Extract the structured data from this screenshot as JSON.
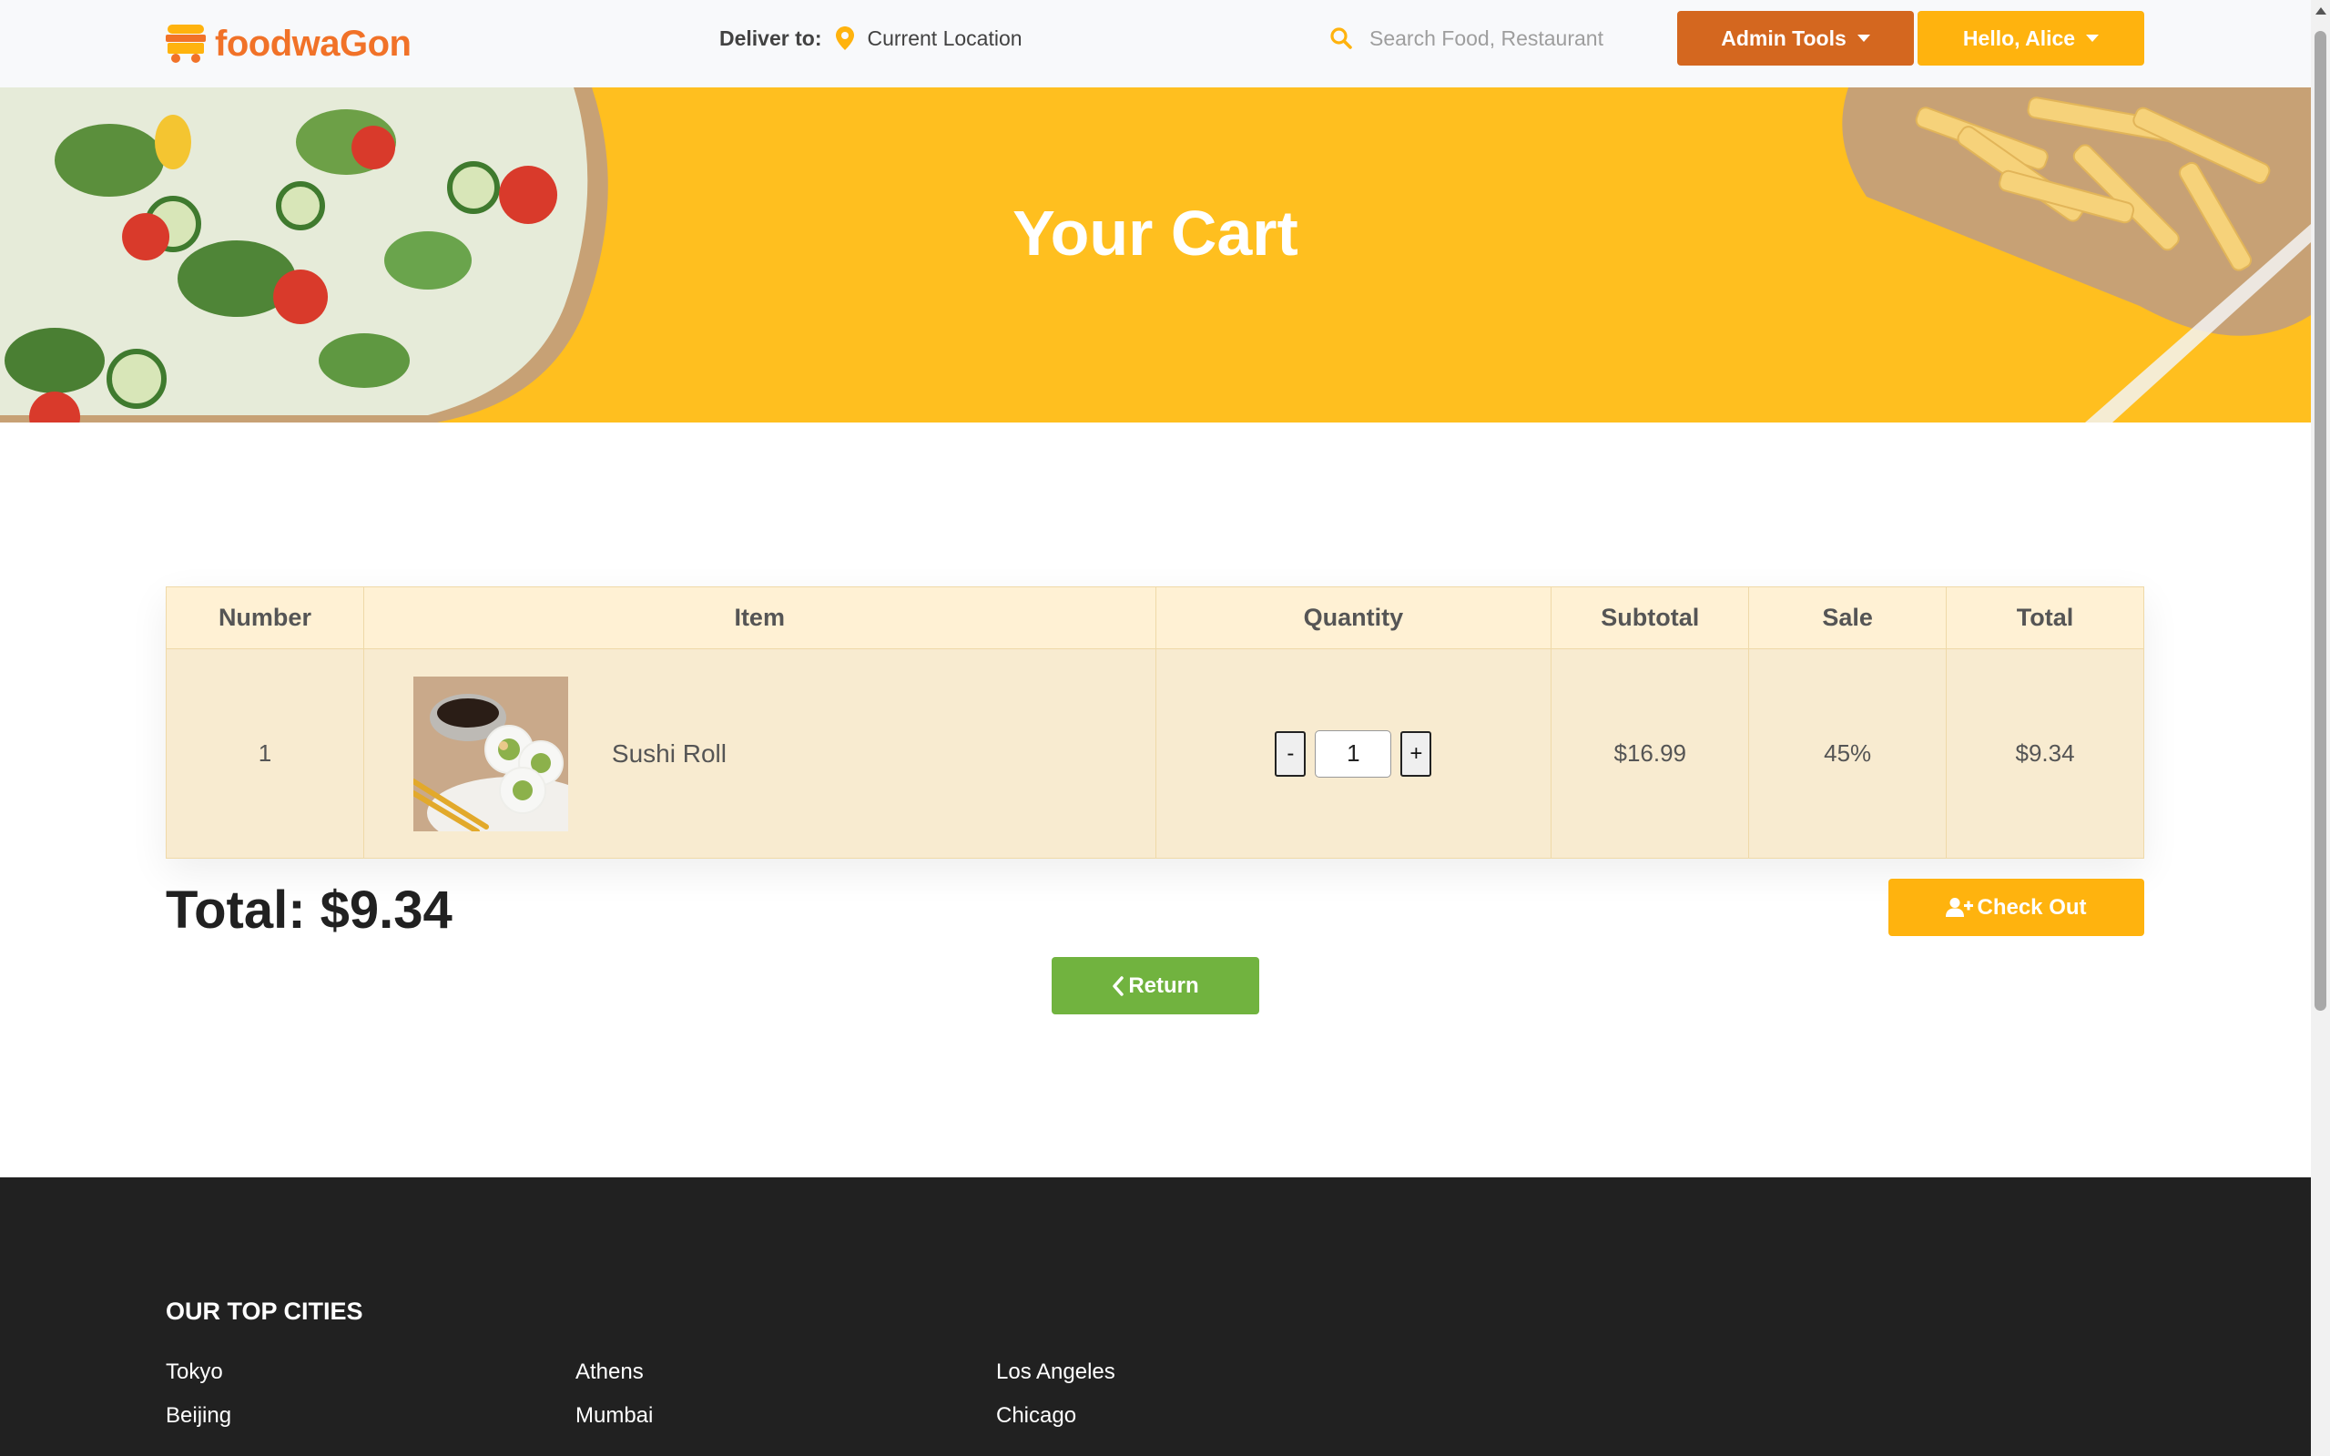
{
  "nav": {
    "brand": "foodwaGon",
    "deliver_label": "Deliver to:",
    "deliver_location": "Current Location",
    "search_placeholder": "Search Food, Restaurant",
    "admin_label": "Admin Tools",
    "user_label": "Hello, Alice"
  },
  "hero": {
    "title": "Your Cart"
  },
  "cart": {
    "headers": [
      "Number",
      "Item",
      "Quantity",
      "Subtotal",
      "Sale",
      "Total"
    ],
    "rows": [
      {
        "number": "1",
        "item": "Sushi Roll",
        "quantity": "1",
        "subtotal": "$16.99",
        "sale": "45%",
        "total": "$9.34"
      }
    ],
    "minus_label": "-",
    "plus_label": "+",
    "grand_total": "Total: $9.34",
    "checkout_label": "Check Out",
    "return_label": "Return"
  },
  "footer": {
    "heading": "OUR TOP CITIES",
    "cities": [
      "Tokyo",
      "Athens",
      "Los Angeles",
      "Beijing",
      "Mumbai",
      "Chicago"
    ]
  },
  "colors": {
    "brand_orange": "#f17228",
    "brand_yellow": "#ffb30e",
    "admin_button": "#d4671f",
    "return_green": "#71b33f",
    "footer_bg": "#212121"
  }
}
